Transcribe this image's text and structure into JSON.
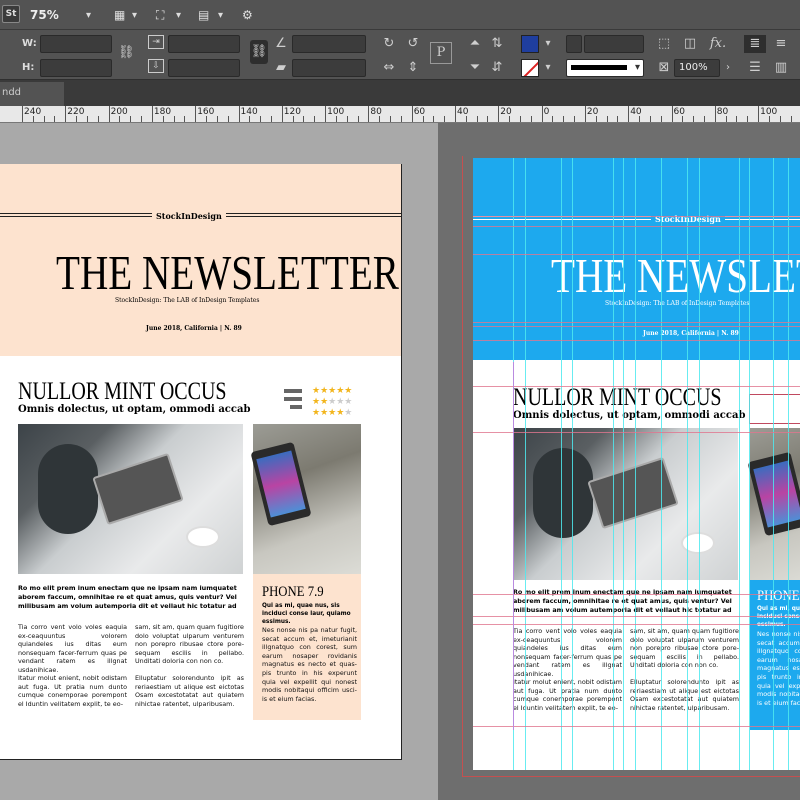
{
  "toolbar": {
    "app_badge": "St",
    "zoom": "75%"
  },
  "control_panel": {
    "w_label": "W:",
    "h_label": "H:",
    "scale_value": "100%"
  },
  "tab": {
    "doc_name": "ndd"
  },
  "ruler": {
    "labels": [
      "240",
      "220",
      "200",
      "180",
      "160",
      "140",
      "120",
      "100",
      "80",
      "60",
      "40",
      "20",
      "0",
      "20",
      "40",
      "60",
      "80",
      "100"
    ]
  },
  "newsletter": {
    "brand": "StockInDesign",
    "title": "THE NEWSLETTER",
    "tagline": "StockInDesign: The LAB of InDesign Templates",
    "date": "June 2018, California | N. 89",
    "headline": "NULLOR MINT OCCUS",
    "subhead": "Omnis dolectus, ut optam, ommodi accab",
    "lead": "Ro mo elit prem inum enectam que ne ipsam nam iumquatet aborem faccum, omnihitae re et quat amus, quis ventur? Vel milibusam am volum autemporia dit et vellaut hic totatur ad",
    "col1": "Tia corro vent volo voles eaquia ex-ceaquuntus volorem quiandeles ius ditas eum nonsequam facer-ferrum quas pe vendant ratem es illgnat usdanihicae.",
    "col1b": "Itatur molut enient, nobit odistam aut fuga. Ut pratia num dunto cumque conemporae porempont el Iduntin velitatem explit, te eo-",
    "col2": "sam, sit am, quam quam fugitiore dolo voluptat ulparum venturem non porepro ribusae ctore pore-sequam escilis in pellabo. Unditati doloria con non co.",
    "col2b": "Elluptatur solorendunto ipit as reriaestiam ut alique est eictotas Osam excestotatat aut quiatem nihictae ratentet, ulparibusam.",
    "sidebar_title": "PHONE 7.9",
    "sidebar_lead": "Qui as mi, quae nus, sis inciduci conse laur, quiamo essimus.",
    "sidebar_body": "Nes nonse nis pa natur fugit, secat accum et, imeturianit illgnatquo con corest, sum earum nosaper rovidanis magnatus es necto et quas-pis trunto in his experunt quia vel expellit qui nonest modis nobitaqui officim usci-is et eium facias."
  },
  "colors": {
    "left_header": "#fde3cf",
    "right_header": "#1da9ee",
    "star": "#f2b51c",
    "guide": "#4ee9ee"
  },
  "rating": [
    5,
    2,
    4
  ]
}
